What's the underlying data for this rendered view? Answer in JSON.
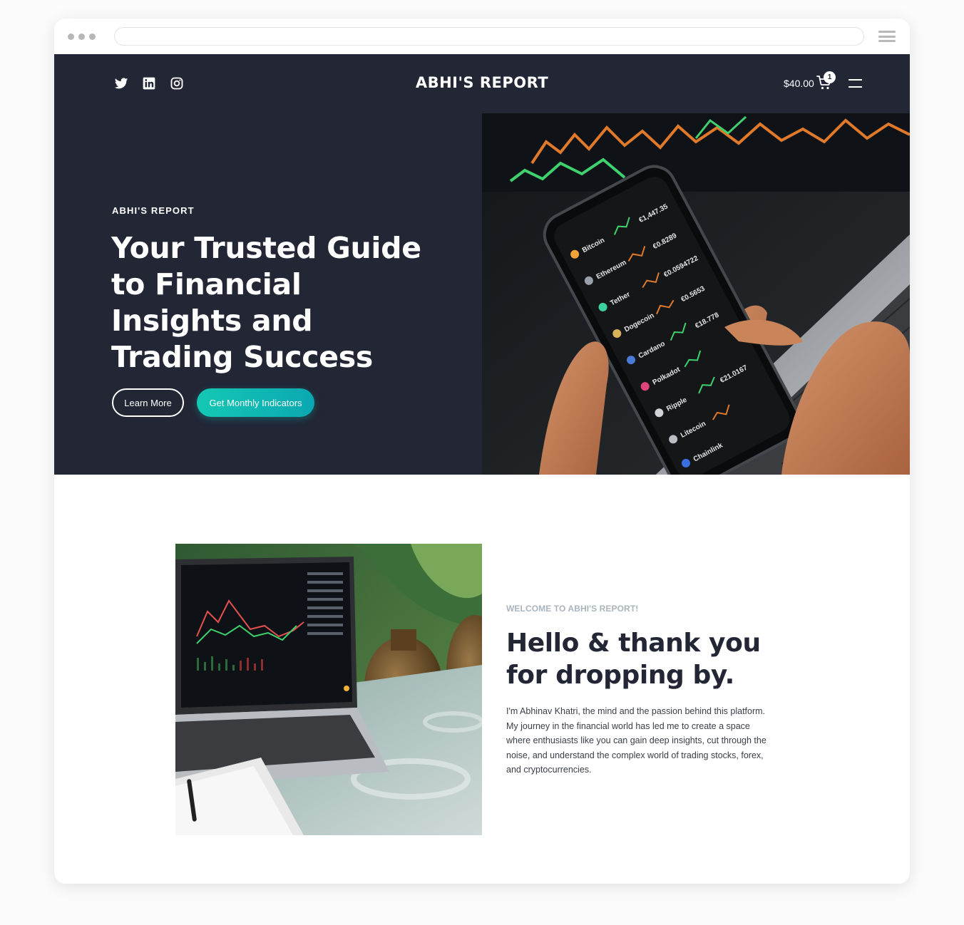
{
  "browser": {
    "menu_icon": "hamburger-icon"
  },
  "header": {
    "social_icons": [
      "twitter-icon",
      "linkedin-icon",
      "instagram-icon"
    ],
    "site_title": "ABHI'S REPORT",
    "cart_total": "$40.00",
    "cart_count": "1",
    "cart_icon": "cart-icon",
    "menu_icon": "menu-icon"
  },
  "hero": {
    "eyebrow": "ABHI'S REPORT",
    "heading": "Your Trusted Guide to Financial Insights and Trading Success",
    "learn_more_label": "Learn More",
    "cta_label": "Get Monthly Indicators",
    "image_alt": "Hands holding smartphone showing crypto prices in front of a laptop with trading charts",
    "phone_rows": [
      {
        "name": "Bitcoin",
        "value": "€1,447.35"
      },
      {
        "name": "Ethereum",
        "value": "€0.8289"
      },
      {
        "name": "Tether",
        "value": "€0.0594722"
      },
      {
        "name": "Dogecoin",
        "value": "€0.5653"
      },
      {
        "name": "Cardano",
        "value": "€18.778"
      },
      {
        "name": "Polkadot",
        "value": ""
      },
      {
        "name": "Ripple",
        "value": "€21.0167"
      },
      {
        "name": "Litecoin",
        "value": ""
      },
      {
        "name": "Chainlink",
        "value": ""
      }
    ]
  },
  "about": {
    "image_alt": "Laptop showing a trading chart on a glass table",
    "eyebrow": "WELCOME TO ABHI'S REPORT!",
    "heading": "Hello & thank you for dropping by.",
    "body": "I'm Abhinav Khatri, the mind and the passion behind this platform. My journey in the financial world has led me to create a space where enthusiasts like you can gain deep insights, cut through the noise, and understand the complex world of trading stocks, forex, and cryptocurrencies."
  },
  "colors": {
    "hero_bg": "#222635",
    "accent": "#14c8b4",
    "heading_dark": "#222635",
    "eyebrow_muted": "#aab4bd"
  }
}
